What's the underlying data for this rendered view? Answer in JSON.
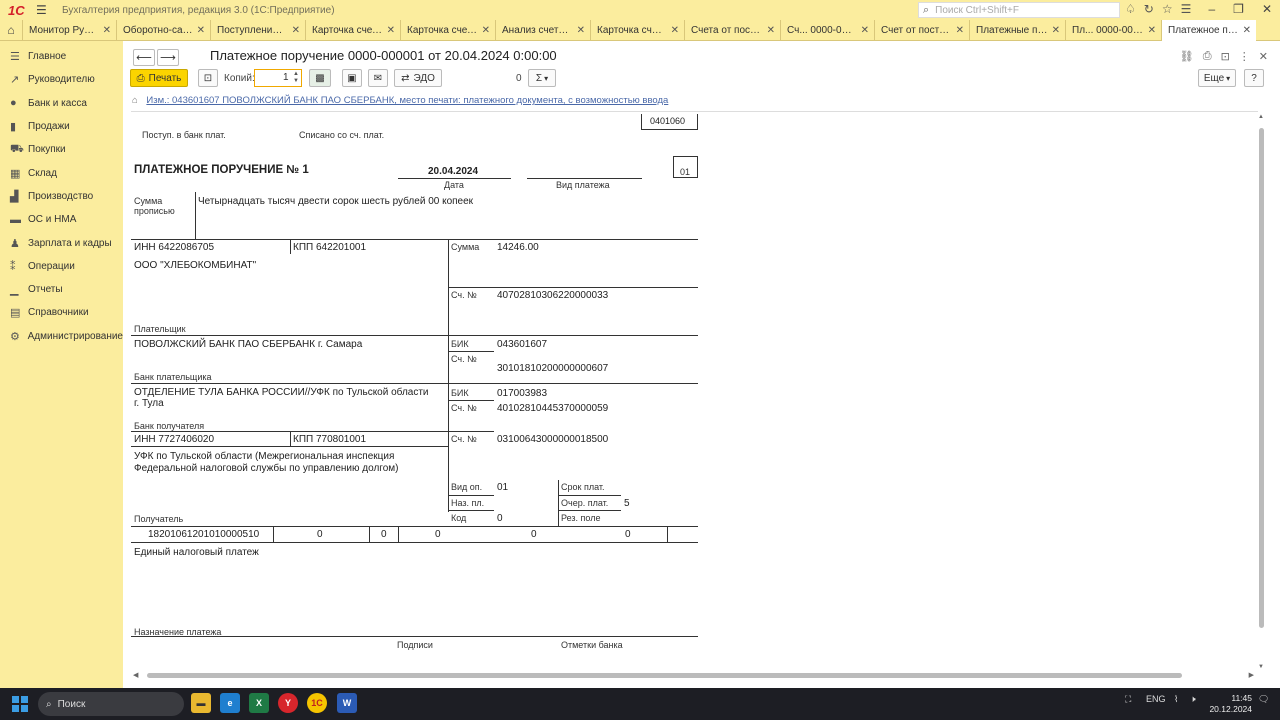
{
  "titlebar": {
    "app_title": "Бухгалтерия предприятия, редакция 3.0 (1С:Предприятие)",
    "search_placeholder": "Поиск Ctrl+Shift+F"
  },
  "tabs": [
    {
      "label": "Монитор Руково..."
    },
    {
      "label": "Оборотно-сальд..."
    },
    {
      "label": "Поступление (а..."
    },
    {
      "label": "Карточка счета ..."
    },
    {
      "label": "Карточка счета ..."
    },
    {
      "label": "Анализ счета 6..."
    },
    {
      "label": "Карточка счета ..."
    },
    {
      "label": "Счета от постав..."
    },
    {
      "label": "Сч... 0000-000001"
    },
    {
      "label": "Счет от постав..."
    },
    {
      "label": "Платежные пор..."
    },
    {
      "label": "Пл... 0000-000001"
    },
    {
      "label": "Платежное пор..."
    }
  ],
  "sidebar": {
    "items": [
      {
        "label": "Главное",
        "icon": "menu-icon"
      },
      {
        "label": "Руководителю",
        "icon": "chart-icon"
      },
      {
        "label": "Банк и касса",
        "icon": "bank-icon"
      },
      {
        "label": "Продажи",
        "icon": "sales-icon"
      },
      {
        "label": "Покупки",
        "icon": "cart-icon"
      },
      {
        "label": "Склад",
        "icon": "warehouse-icon"
      },
      {
        "label": "Производство",
        "icon": "factory-icon"
      },
      {
        "label": "ОС и НМА",
        "icon": "assets-icon"
      },
      {
        "label": "Зарплата и кадры",
        "icon": "person-icon"
      },
      {
        "label": "Операции",
        "icon": "operations-icon"
      },
      {
        "label": "Отчеты",
        "icon": "reports-icon"
      },
      {
        "label": "Справочники",
        "icon": "book-icon"
      },
      {
        "label": "Администрирование",
        "icon": "gear-icon"
      }
    ]
  },
  "header": {
    "title": "Платежное поручение 0000-000001 от 20.04.2024 0:00:00"
  },
  "toolbar": {
    "print_label": "Печать",
    "copies_label": "Копий:",
    "copies_value": "1",
    "edo_label": "ЭДО",
    "sum_value": "0",
    "sum_symbol": "Σ",
    "more_label": "Еще",
    "help_label": "?"
  },
  "bank_link": "Изм.: 043601607 ПОВОЛЖСКИЙ БАНК ПАО СБЕРБАНК, место печати: платежного документа, с возможностью ввода",
  "document": {
    "form_code": "0401060",
    "received_label": "Поступ. в банк плат.",
    "debited_label": "Списано со сч. плат.",
    "heading": "ПЛАТЕЖНОЕ ПОРУЧЕНИЕ № 1",
    "date": "20.04.2024",
    "date_label": "Дата",
    "payment_type_label": "Вид платежа",
    "status_code": "01",
    "sum_in_words_label_1": "Сумма",
    "sum_in_words_label_2": "прописью",
    "sum_in_words": "Четырнадцать тысяч двести сорок шесть рублей 00 копеек",
    "payer_inn": "ИНН 6422086705",
    "payer_kpp": "КПП 642201001",
    "sum_label": "Сумма",
    "sum": "14246.00",
    "payer_name": "ООО \"ХЛЕБОКОМБИНАТ\"",
    "account_label": "Сч. №",
    "payer_account": "40702810306220000033",
    "payer_label": "Плательщик",
    "payer_bank": "ПОВОЛЖСКИЙ БАНК ПАО СБЕРБАНК г. Самара",
    "bik_label": "БИК",
    "payer_bik": "043601607",
    "payer_bank_account": "30101810200000000607",
    "payer_bank_label": "Банк плательщика",
    "recipient_bank_1": "ОТДЕЛЕНИЕ ТУЛА БАНКА РОССИИ//УФК по Тульской области",
    "recipient_bank_2": "г. Тула",
    "recipient_bik": "017003983",
    "recipient_bank_account": "40102810445370000059",
    "recipient_bank_label": "Банк получателя",
    "recipient_inn": "ИНН 7727406020",
    "recipient_kpp": "КПП 770801001",
    "recipient_account": "03100643000000018500",
    "recipient_name_1": "УФК по Тульской области (Межрегиональная инспекция",
    "recipient_name_2": "Федеральной налоговой службы по управлению долгом)",
    "op_type_label": "Вид оп.",
    "op_type": "01",
    "due_label": "Срок плат.",
    "purpose_code_label": "Наз. пл.",
    "order_label": "Очер. плат.",
    "order": "5",
    "code_label": "Код",
    "code": "0",
    "reserve_label": "Рез. поле",
    "recipient_label": "Получатель",
    "kbk": "18201061201010000510",
    "field_1": "0",
    "field_2": "0",
    "field_3": "0",
    "field_4": "0",
    "field_5": "0",
    "purpose": "Единый налоговый платеж",
    "purpose_label": "Назначение платежа",
    "signatures_label": "Подписи",
    "bank_marks_label": "Отметки банка"
  },
  "taskbar": {
    "search_label": "Поиск",
    "lang": "ENG",
    "time": "11:45",
    "date": "20.12.2024"
  },
  "colors": {
    "panel_yellow": "#fbed9e",
    "print_button": "#fbd400",
    "link_blue": "#2a4e9a",
    "brand_red": "#d4202a"
  }
}
